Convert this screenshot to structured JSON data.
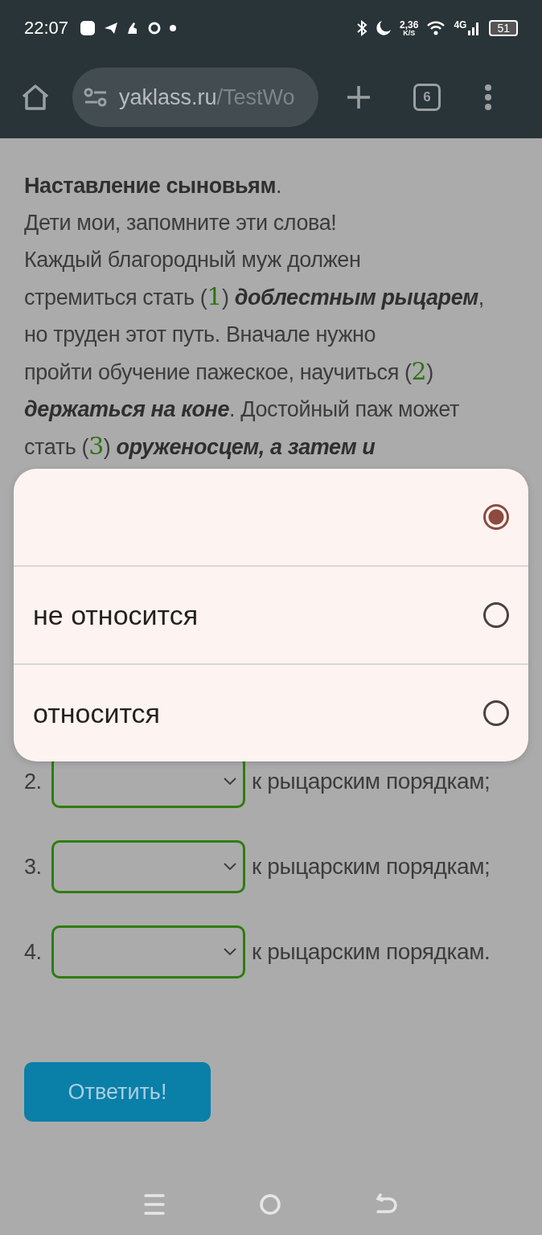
{
  "status_bar": {
    "time": "22:07",
    "speed": "2,36",
    "speed_unit": "K/S",
    "network": "4G",
    "battery": "51"
  },
  "browser": {
    "url_host": "yaklass.ru",
    "url_path": "/TestWo",
    "tab_count": "6"
  },
  "article": {
    "title": "**Наставление сыновьям**.",
    "greeting": "Дети мои, запомните эти слова!",
    "lines": [
      [
        {
          "kind": "text",
          "text": "Каждый благородный муж должен"
        }
      ],
      [
        {
          "kind": "text",
          "text": "стремиться стать ("
        },
        {
          "kind": "marker",
          "text": "1"
        },
        {
          "kind": "text",
          "text": ") "
        },
        {
          "kind": "emphasis",
          "text": "доблестным рыцарем"
        },
        {
          "kind": "text",
          "text": ","
        }
      ],
      [
        {
          "kind": "text",
          "text": "но труден этот путь. Вначале нужно"
        }
      ],
      [
        {
          "kind": "text",
          "text": "пройти обучение пажеское, научиться ("
        },
        {
          "kind": "marker",
          "text": "2"
        },
        {
          "kind": "text",
          "text": ")"
        }
      ],
      [
        {
          "kind": "emphasis",
          "text": "держаться на коне"
        },
        {
          "kind": "text",
          "text": ". Достойный паж может"
        }
      ],
      [
        {
          "kind": "text",
          "text": "стать ("
        },
        {
          "kind": "marker",
          "text": "3"
        },
        {
          "kind": "text",
          "text": ") "
        },
        {
          "kind": "emphasis",
          "text": "оруженосцем, а затем и"
        }
      ]
    ]
  },
  "answers": [
    {
      "number": "2.",
      "suffix": "к рыцарским порядкам;"
    },
    {
      "number": "3.",
      "suffix": "к рыцарским порядкам;"
    },
    {
      "number": "4.",
      "suffix": "к рыцарским порядкам."
    }
  ],
  "submit_button": "Ответить!",
  "dropdown_menu": {
    "options": [
      {
        "selected": true
      },
      {
        "label": "не относится",
        "selected": false
      },
      {
        "label": "относится",
        "selected": false
      }
    ]
  }
}
